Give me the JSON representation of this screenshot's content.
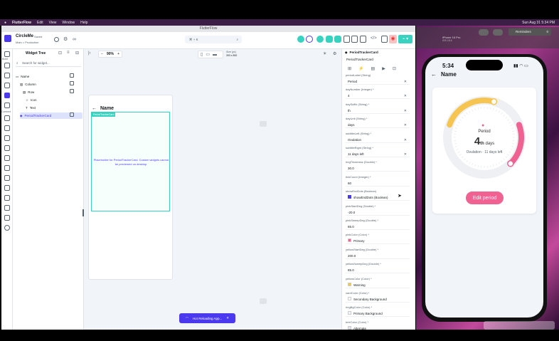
{
  "menubar": {
    "app": "FlutterFlow",
    "items": [
      "Edit",
      "View",
      "Window",
      "Help"
    ],
    "clock": "Sun Aug 31  5:34 PM"
  },
  "window": {
    "title": "FlutterFlow"
  },
  "project": {
    "name": "CircleMe",
    "status": "Saved",
    "branch": "Main > Production"
  },
  "toolbar": {
    "search_shortcut": "⌘ + K",
    "zoom": "90%",
    "size_label": "Size (px)",
    "size_value": "393 x 852"
  },
  "tree": {
    "title": "Widget Tree",
    "search_placeholder": "Search for widget...",
    "items": [
      {
        "label": "Name"
      },
      {
        "label": "Column"
      },
      {
        "label": "Row"
      },
      {
        "label": "Icon"
      },
      {
        "label": "Text"
      },
      {
        "label": "PeriodTrackerCard"
      }
    ]
  },
  "preview": {
    "page_title": "Name",
    "widget_tag": "PeriodTrackerCard",
    "placeholder": "Placeholder for PeriodTrackerCard. Custom widgets cannot be previewed on desktop."
  },
  "properties": {
    "header": "PeriodTrackerCard",
    "subheader": "PeriodTrackerCard",
    "fields": [
      {
        "label": "periodLabel (String)",
        "value": "Period"
      },
      {
        "label": "dayNumber (Integer) *",
        "value": "4"
      },
      {
        "label": "daySuffix (String) *",
        "value": "th"
      },
      {
        "label": "dayUnit (String) *",
        "value": "days"
      },
      {
        "label": "subtitleLeft (String) *",
        "value": "Ovulation"
      },
      {
        "label": "subtitleRight (String) *",
        "value": "11 days left"
      },
      {
        "label": "ringThickness (Double) *",
        "value": "30.0"
      },
      {
        "label": "tickCount (Integer) *",
        "value": "60"
      },
      {
        "label": "showEndDots (Boolean)",
        "value": "showEndDots (Boolean)"
      },
      {
        "label": "pinkStartDeg (Double) *",
        "value": "-20.0"
      },
      {
        "label": "pinkSweepDeg (Double) *",
        "value": "65.0"
      },
      {
        "label": "pinkColor (Color) *",
        "value": "Primary"
      },
      {
        "label": "yellowStartDeg (Double) *",
        "value": "200.0"
      },
      {
        "label": "yellowSweepDeg (Double) *",
        "value": "85.0"
      },
      {
        "label": "yellowColor (Color) *",
        "value": "Warning"
      },
      {
        "label": "cardColor (Color) *",
        "value": "Secondary Background"
      },
      {
        "label": "ringBgColor (Color) *",
        "value": "Primary Background"
      },
      {
        "label": "textColor (Color) *",
        "value": "Alternate"
      }
    ]
  },
  "hotreload": {
    "label": "Hot Reloading App..."
  },
  "simulator": {
    "device": "iPhone 16 Pro",
    "os": "iOS 18.4",
    "reminders": "Reminders",
    "time": "5:34",
    "page_title": "Name",
    "card": {
      "label": "Period",
      "day": "4",
      "suffix": "th",
      "unit": "days",
      "sub_left": "Ovulation",
      "sub_right": "11 days left",
      "button": "Edit period"
    }
  },
  "colors": {
    "accent": "#4b39ef",
    "pink": "#f06292",
    "yellow": "#f5c451",
    "ring_bg": "#eef0f3"
  }
}
